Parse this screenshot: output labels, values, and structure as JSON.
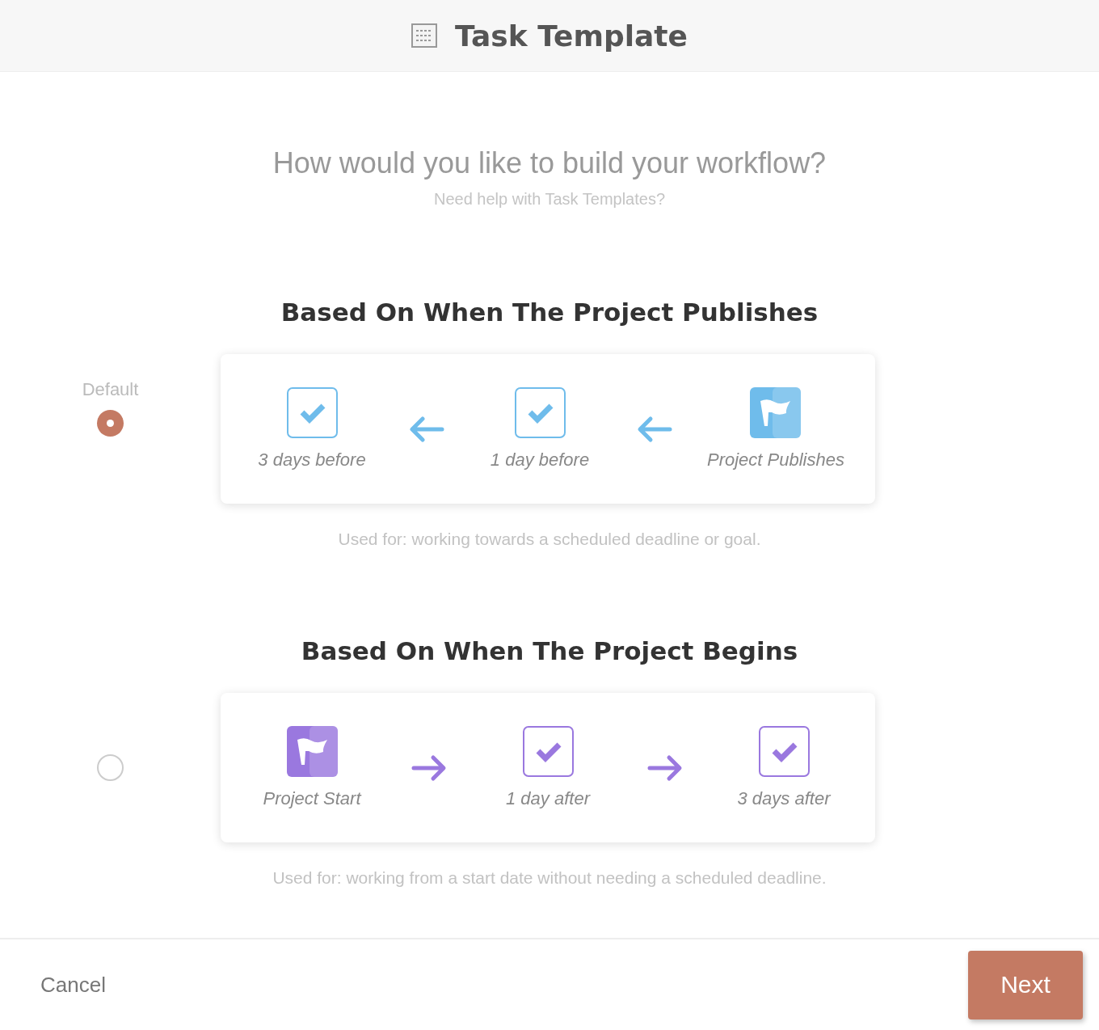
{
  "header": {
    "title": "Task Template"
  },
  "question": "How would you like to build your workflow?",
  "help_link": "Need help with Task Templates?",
  "options": [
    {
      "title": "Based On When The Project Publishes",
      "default_label": "Default",
      "selected": true,
      "color": "#6fbceb",
      "arrows_backward": true,
      "steps": [
        {
          "kind": "task",
          "label": "3 days before"
        },
        {
          "kind": "task",
          "label": "1 day before"
        },
        {
          "kind": "milestone",
          "label": "Project Publishes"
        }
      ],
      "usage": "Used for: working towards a scheduled deadline or goal."
    },
    {
      "title": "Based On When The Project Begins",
      "selected": false,
      "color": "#9a78df",
      "arrows_backward": false,
      "steps": [
        {
          "kind": "milestone",
          "label": "Project Start"
        },
        {
          "kind": "task",
          "label": "1 day after"
        },
        {
          "kind": "task",
          "label": "3 days after"
        }
      ],
      "usage": "Used for: working from a start date without needing a scheduled deadline."
    }
  ],
  "footer": {
    "cancel": "Cancel",
    "next": "Next"
  }
}
